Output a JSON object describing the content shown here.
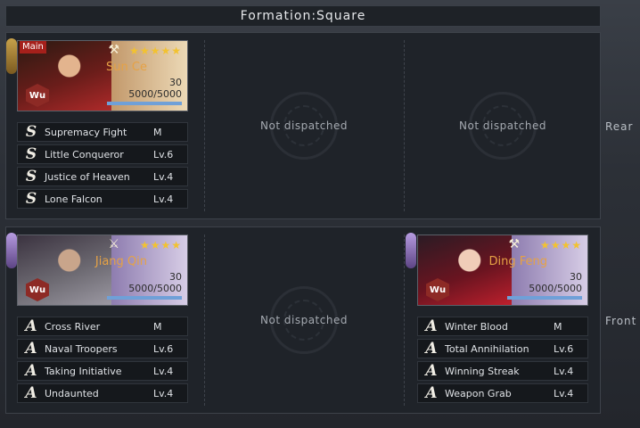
{
  "title": "Formation:Square",
  "labels": {
    "rear": "Rear",
    "front": "Front",
    "empty": "Not dispatched"
  },
  "colors": {
    "accent_gold": "#e6a245",
    "stars": "#f2c230",
    "red_frame": "#7a2b24",
    "purple_frame": "#3b2f52",
    "faction": "#8d2a25"
  },
  "rows": {
    "rear": {
      "slot1": {
        "main_tag": "Main",
        "name": "Sun Ce",
        "stars": "★★★★★",
        "star_count": 5,
        "weapon_icon": "axe-icon",
        "level": "30",
        "troops": "5000/5000",
        "troops_fraction": 1.0,
        "faction": "Wu",
        "skills": [
          {
            "grade": "S",
            "name": "Supremacy Fight",
            "level": "M"
          },
          {
            "grade": "S",
            "name": "Little Conqueror",
            "level": "Lv.6"
          },
          {
            "grade": "S",
            "name": "Justice of Heaven",
            "level": "Lv.4"
          },
          {
            "grade": "S",
            "name": "Lone Falcon",
            "level": "Lv.4"
          }
        ]
      }
    },
    "front": {
      "slot1": {
        "name": "Jiang Qin",
        "stars": "★★★★",
        "star_count": 4,
        "weapon_icon": "swords-icon",
        "level": "30",
        "troops": "5000/5000",
        "troops_fraction": 1.0,
        "faction": "Wu",
        "skills": [
          {
            "grade": "A",
            "name": "Cross River",
            "level": "M"
          },
          {
            "grade": "A",
            "name": "Naval Troopers",
            "level": "Lv.6"
          },
          {
            "grade": "A",
            "name": "Taking Initiative",
            "level": "Lv.4"
          },
          {
            "grade": "A",
            "name": "Undaunted",
            "level": "Lv.4"
          }
        ]
      },
      "slot3": {
        "name": "Ding Feng",
        "stars": "★★★★",
        "star_count": 4,
        "weapon_icon": "axe-icon",
        "level": "30",
        "troops": "5000/5000",
        "troops_fraction": 1.0,
        "faction": "Wu",
        "skills": [
          {
            "grade": "A",
            "name": "Winter Blood",
            "level": "M"
          },
          {
            "grade": "A",
            "name": "Total Annihilation",
            "level": "Lv.6"
          },
          {
            "grade": "A",
            "name": "Winning Streak",
            "level": "Lv.4"
          },
          {
            "grade": "A",
            "name": "Weapon Grab",
            "level": "Lv.4"
          }
        ]
      }
    }
  }
}
